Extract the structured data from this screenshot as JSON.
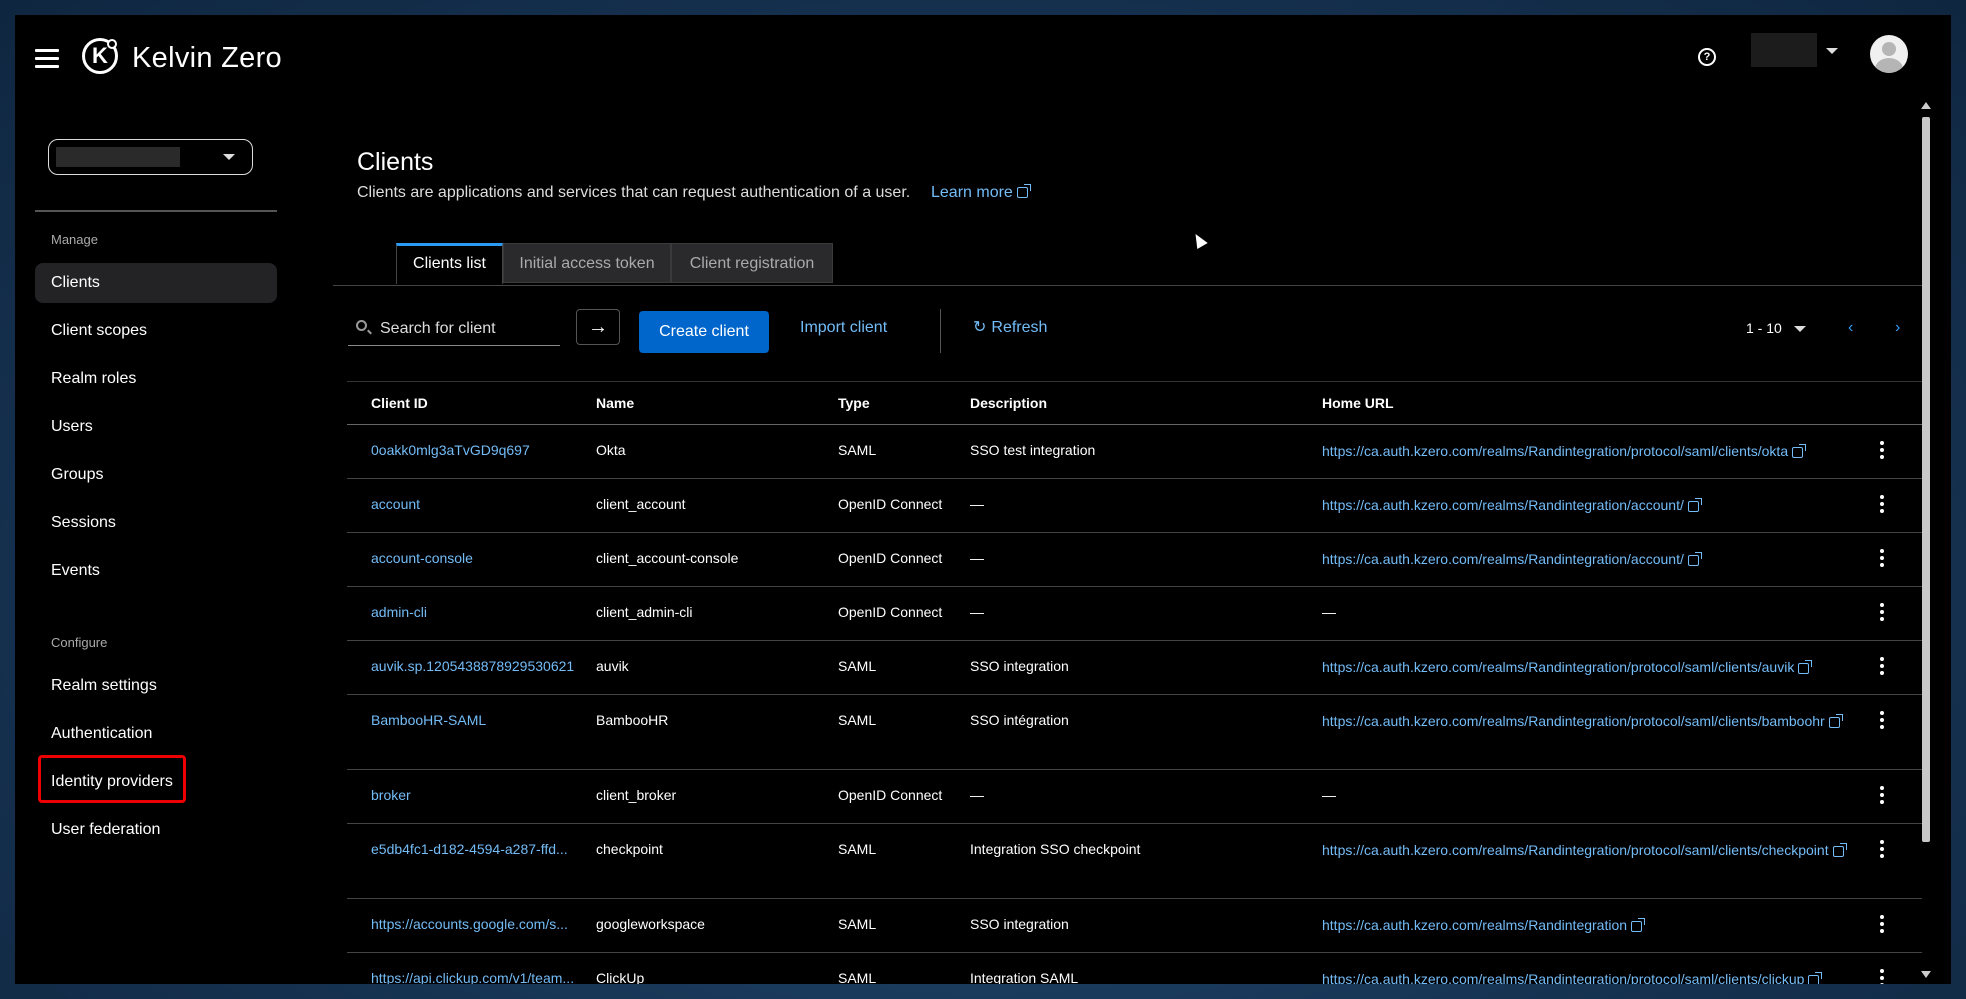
{
  "header": {
    "brand": "Kelvin Zero",
    "logo_letter": "K"
  },
  "sidebar": {
    "manage_label": "Manage",
    "configure_label": "Configure",
    "manage_items": [
      {
        "label": "Clients",
        "active": true
      },
      {
        "label": "Client scopes"
      },
      {
        "label": "Realm roles"
      },
      {
        "label": "Users"
      },
      {
        "label": "Groups"
      },
      {
        "label": "Sessions"
      },
      {
        "label": "Events"
      }
    ],
    "configure_items": [
      {
        "label": "Realm settings"
      },
      {
        "label": "Authentication"
      },
      {
        "label": "Identity providers",
        "highlighted": true
      },
      {
        "label": "User federation"
      }
    ]
  },
  "main": {
    "title": "Clients",
    "description": "Clients are applications and services that can request authentication of a user.",
    "learn_more": "Learn more",
    "tabs": [
      {
        "label": "Clients list",
        "active": true
      },
      {
        "label": "Initial access token"
      },
      {
        "label": "Client registration"
      }
    ],
    "toolbar": {
      "search_placeholder": "Search for client",
      "search_go": "→",
      "create_client": "Create client",
      "import_client": "Import client",
      "refresh": "Refresh",
      "pagination": "1 - 10",
      "prev": "‹",
      "next": "›"
    },
    "table": {
      "headers": [
        "Client ID",
        "Name",
        "Type",
        "Description",
        "Home URL"
      ],
      "rows": [
        {
          "client_id": "0oakk0mlg3aTvGD9q697",
          "name": "Okta",
          "type": "SAML",
          "description": "SSO test integration",
          "home_url": "https://ca.auth.kzero.com/realms/Randintegration/protocol/saml/clients/okta"
        },
        {
          "client_id": "account",
          "name": "client_account",
          "type": "OpenID Connect",
          "description": "—",
          "home_url": "https://ca.auth.kzero.com/realms/Randintegration/account/"
        },
        {
          "client_id": "account-console",
          "name": "client_account-console",
          "type": "OpenID Connect",
          "description": "—",
          "home_url": "https://ca.auth.kzero.com/realms/Randintegration/account/"
        },
        {
          "client_id": "admin-cli",
          "name": "client_admin-cli",
          "type": "OpenID Connect",
          "description": "—",
          "home_url": "—"
        },
        {
          "client_id": "auvik.sp.1205438878929530621",
          "name": "auvik",
          "type": "SAML",
          "description": "SSO integration",
          "home_url": "https://ca.auth.kzero.com/realms/Randintegration/protocol/saml/clients/auvik"
        },
        {
          "client_id": "BambooHR-SAML",
          "name": "BambooHR",
          "type": "SAML",
          "description": "SSO intégration",
          "home_url": "https://ca.auth.kzero.com/realms/Randintegration/protocol/saml/clients/bamboohr"
        },
        {
          "client_id": "broker",
          "name": "client_broker",
          "type": "OpenID Connect",
          "description": "—",
          "home_url": "—"
        },
        {
          "client_id": "e5db4fc1-d182-4594-a287-ffd...",
          "name": "checkpoint",
          "type": "SAML",
          "description": "Integration SSO checkpoint",
          "home_url": "https://ca.auth.kzero.com/realms/Randintegration/protocol/saml/clients/checkpoint"
        },
        {
          "client_id": "https://accounts.google.com/s...",
          "name": "googleworkspace",
          "type": "SAML",
          "description": "SSO integration",
          "home_url": "https://ca.auth.kzero.com/realms/Randintegration"
        },
        {
          "client_id": "https://api.clickup.com/v1/team...",
          "name": "ClickUp",
          "type": "SAML",
          "description": "Integration SAML",
          "home_url": "https://ca.auth.kzero.com/realms/Randintegration/protocol/saml/clients/clickup"
        }
      ]
    }
  },
  "colors": {
    "link": "#73bcf7",
    "primary": "#0066cc",
    "accent": "#2b9af3",
    "highlight": "#ee0000"
  }
}
